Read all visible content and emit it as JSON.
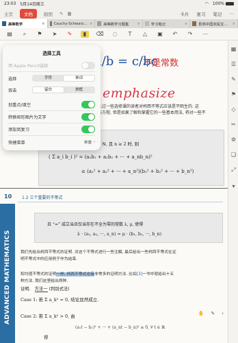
{
  "status": {
    "time": "23:03",
    "date": "5月14日周三",
    "battery": "100%"
  },
  "appbar": {
    "tabs": [
      "主页",
      "文档",
      "翻图"
    ],
    "active_tab": "文档",
    "right": [
      "卡片",
      "复习",
      "笔记"
    ]
  },
  "doc_tabs": [
    {
      "label": "高等数学",
      "active": true
    },
    {
      "label": "Cauchy-Schwarz…",
      "active": false
    },
    {
      "label": "高等数学习题集",
      "active": false
    },
    {
      "label": "学习笔记",
      "active": false
    },
    {
      "label": "影响中国农民文…",
      "active": false
    }
  ],
  "page1": {
    "handwritten_fraction": "a/b = c/bc",
    "note_red": "不是常数",
    "emphasize": "emphasize",
    "text_fragment1": "上过一些选修课的读者对柯西不等式应该是不陌生的. 这",
    "text_fragment2": "与方程, 但是如果了解和掌握它的一些基本用法, 将对一些不",
    "theorem_line": "x,  ∀ a_i, b_i ∈ ℝ,  n ∈ ℕ,  且 n ≥ 2  时, 则",
    "inequality1": "( Σ a_i b_i )² = (a₁b₁ + a₂b₂ + ··· + a_nb_n)²",
    "inequality2": "≤ (a₁² + a₂² + ··· + a_n²)(b₁² + b₂² + ··· + b_n²)"
  },
  "popover": {
    "title": "选择工具",
    "apple_pencil_label": "用 Apple Pencil选择",
    "select_label": "选择",
    "select_options": [
      "字符",
      "单词"
    ],
    "select_selected": "单词",
    "double_tap_label": "双击",
    "double_tap_options": [
      "留白",
      "放框"
    ],
    "double_tap_selected": "留白",
    "highlight_label": "划重点/填空",
    "convert_label": "转换矩形图片为文字",
    "review_label": "添加到复习",
    "quick_menu_label": "快捷菜单",
    "new_label": "新建"
  },
  "page2": {
    "page_number": "10",
    "section": "1.2    三个重要的不等式",
    "vertical_title": "ADVANCED MATHEMATICS",
    "box_line1": "且 “=” 成立当且仅当存在不全为零的常数 λ, μ, 使得",
    "box_line2": "λ · (a₁, a₂, ···, a_n) = μ · (b₁, b₂, ···, b_n)",
    "para1_a": "我们先给出柯西不等式的证明. 对这个不等式进行一些注解, 最后给出一些柯西不等式在证",
    "para1_b": "明不等式中的应用例子作为结束.",
    "para2_a": "和均值不等式的证明",
    "para2_hl1": "一样, 柯西不等式也有",
    "para2_b": "非常多的证明方法. 比如",
    "para2_ref": "[3]",
    "para2_c": "一书中就给出十五",
    "para2_d": "种方法. 我们这里给出两种.",
    "proof_label": "证明.",
    "method_label": "方法一",
    "method_name": "(判别式法)",
    "case1": "Case 1: 若 Σ a_k² = 0, 结论显然成立.",
    "case2": "Case 2: 若 Σ a_k² > 0, 由",
    "formula": "(a₁t − b₁)² + ··· + (a_nt − b_n)² ≥ 0,   ∀ t ∈ ℝ",
    "de": "得"
  }
}
